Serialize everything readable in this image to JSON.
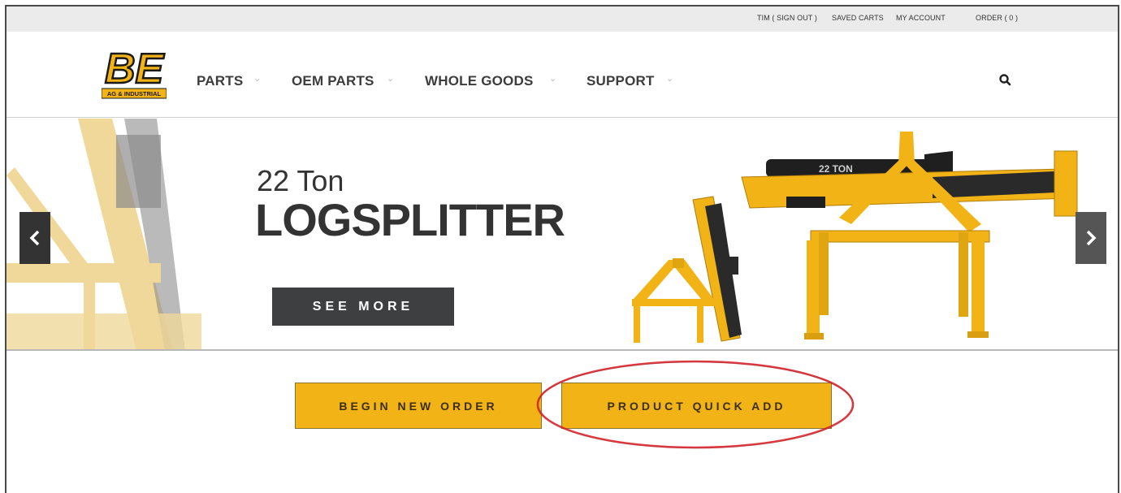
{
  "utility_nav": {
    "user": "TIM ( SIGN OUT )",
    "saved_carts": "SAVED CARTS",
    "my_account": "MY ACCOUNT",
    "order": "ORDER ( 0 )"
  },
  "logo": {
    "letters": "BE",
    "tagline": "AG & INDUSTRIAL"
  },
  "main_nav": [
    {
      "label": "PARTS"
    },
    {
      "label": "OEM PARTS"
    },
    {
      "label": "WHOLE GOODS"
    },
    {
      "label": "SUPPORT"
    }
  ],
  "hero": {
    "subtitle": "22 Ton",
    "title": "LOGSPLITTER",
    "cta": "SEE MORE",
    "product_decal": "22 TON"
  },
  "actions": {
    "begin_new_order": "BEGIN NEW ORDER",
    "product_quick_add": "PRODUCT QUICK ADD"
  },
  "colors": {
    "brand_yellow": "#f2b316",
    "dark": "#3e3f41",
    "highlight_red": "#d9232a"
  }
}
